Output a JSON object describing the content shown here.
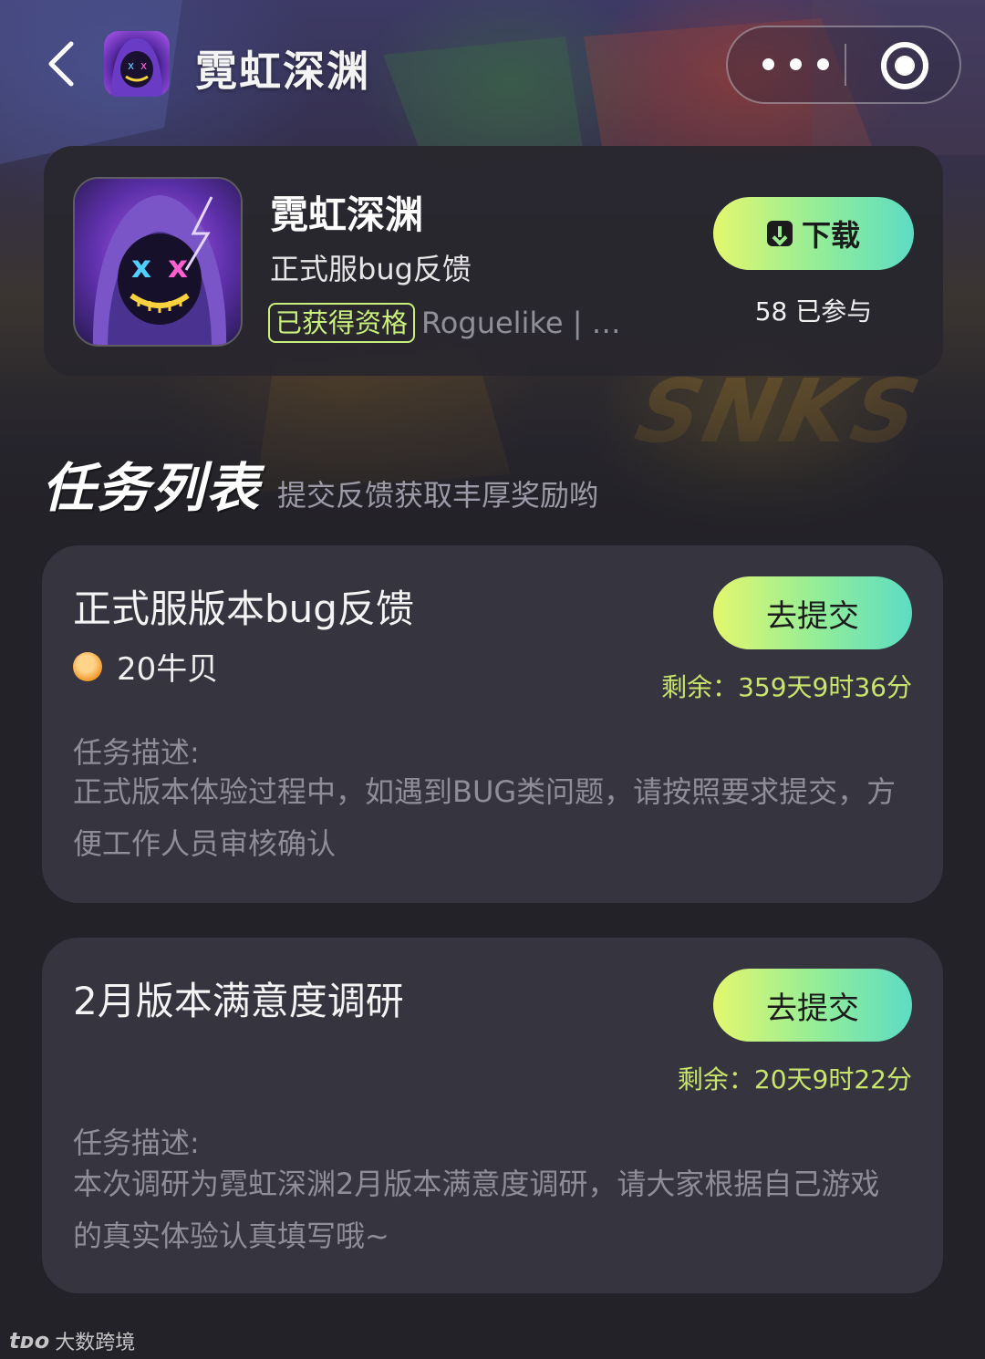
{
  "nav": {
    "title": "霓虹深渊",
    "back_icon": "chevron-left-icon",
    "more_icon": "more-dots-icon",
    "close_icon": "target-close-icon"
  },
  "game": {
    "name": "霓虹深渊",
    "subtitle": "正式服bug反馈",
    "badge": "已获得资格",
    "tags": "Roguelike | 赛…",
    "download_label": "下载",
    "participants": "58 已参与"
  },
  "section": {
    "title": "任务列表",
    "subtitle": "提交反馈获取丰厚奖励哟"
  },
  "tasks": [
    {
      "title": "正式服版本bug反馈",
      "reward": "20牛贝",
      "button": "去提交",
      "remaining": "剩余：359天9时36分",
      "desc_label": "任务描述:",
      "desc": "正式版本体验过程中，如遇到BUG类问题，请按照要求提交，方便工作人员审核确认"
    },
    {
      "title": "2月版本满意度调研",
      "button": "去提交",
      "remaining": "剩余：20天9时22分",
      "desc_label": "任务描述:",
      "desc": "本次调研为霓虹深渊2月版本满意度调研，请大家根据自己游戏的真实体验认真填写哦~"
    }
  ],
  "watermark": {
    "logo": "tᴅᴏ",
    "text": "大数跨境"
  },
  "colors": {
    "accent_green": "#c9f07a",
    "button_gradient_start": "#e4f76d",
    "button_gradient_end": "#5edcc4",
    "remaining_text": "#c9e56c",
    "card_bg": "#36353f",
    "page_bg": "#232228"
  }
}
